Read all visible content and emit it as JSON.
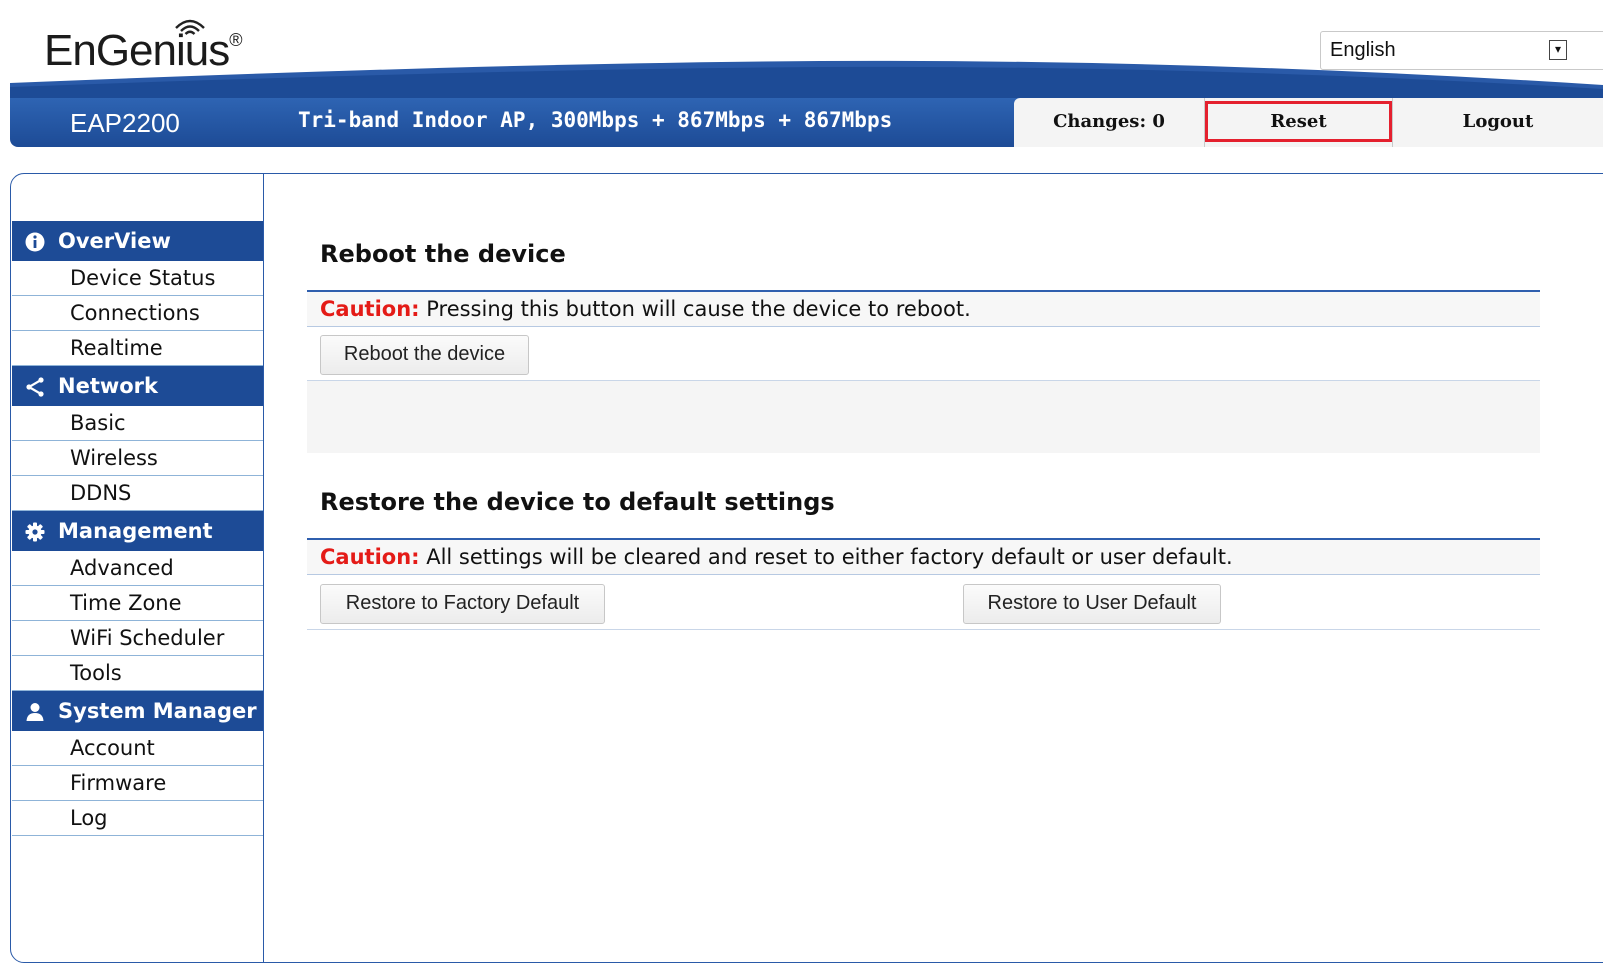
{
  "header": {
    "brand": "EnGenius",
    "brand_mark": "®",
    "language": "English",
    "model": "EAP2200",
    "description": "Tri-band Indoor AP, 300Mbps + 867Mbps + 867Mbps",
    "changes_label": "Changes: 0",
    "reset_label": "Reset",
    "logout_label": "Logout",
    "colors": {
      "banner": "#1d4b96",
      "highlight": "#e4202e"
    }
  },
  "sidebar": {
    "groups": [
      {
        "label": "OverView",
        "icon": "info-icon",
        "items": [
          "Device Status",
          "Connections",
          "Realtime"
        ]
      },
      {
        "label": "Network",
        "icon": "share-icon",
        "items": [
          "Basic",
          "Wireless",
          "DDNS"
        ]
      },
      {
        "label": "Management",
        "icon": "gear-icon",
        "items": [
          "Advanced",
          "Time Zone",
          "WiFi Scheduler",
          "Tools"
        ]
      },
      {
        "label": "System Manager",
        "icon": "user-icon",
        "items": [
          "Account",
          "Firmware",
          "Log"
        ]
      }
    ]
  },
  "main": {
    "reboot": {
      "title": "Reboot the device",
      "caution_label": "Caution:",
      "caution_text": " Pressing this button will cause the device to reboot.",
      "button": "Reboot the device"
    },
    "restore": {
      "title": "Restore the device to default settings",
      "caution_label": "Caution:",
      "caution_text": " All settings will be cleared and reset to either factory default or user default.",
      "factory_button": "Restore to Factory Default",
      "user_button": "Restore to User Default"
    },
    "colors": {
      "caution": "#e41b17"
    }
  }
}
